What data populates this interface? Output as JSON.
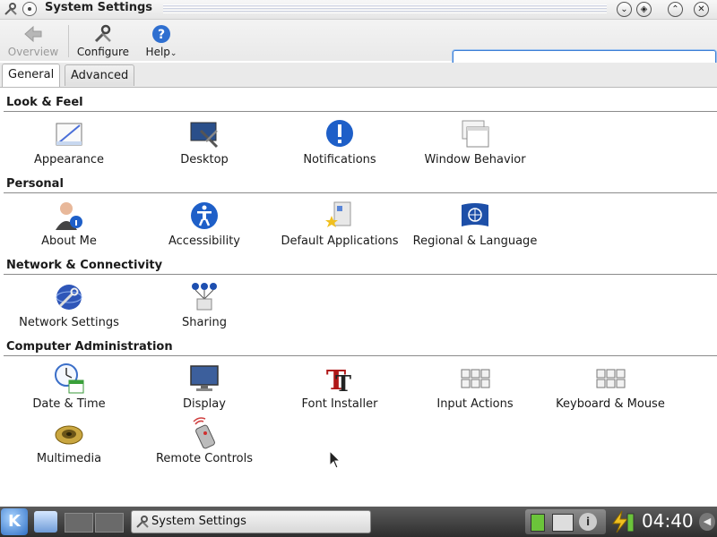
{
  "window": {
    "title": "System Settings"
  },
  "toolbar": {
    "overview_label": "Overview",
    "configure_label": "Configure",
    "help_label": "Help"
  },
  "search": {
    "placeholder": "",
    "value": ""
  },
  "tabs": [
    {
      "label": "General",
      "active": true
    },
    {
      "label": "Advanced",
      "active": false
    }
  ],
  "categories": [
    {
      "title": "Look & Feel",
      "items": [
        {
          "label": "Appearance",
          "icon": "appearance-icon"
        },
        {
          "label": "Desktop",
          "icon": "desktop-icon"
        },
        {
          "label": "Notifications",
          "icon": "notifications-icon"
        },
        {
          "label": "Window Behavior",
          "icon": "window-behavior-icon"
        }
      ]
    },
    {
      "title": "Personal",
      "items": [
        {
          "label": "About Me",
          "icon": "about-me-icon"
        },
        {
          "label": "Accessibility",
          "icon": "accessibility-icon"
        },
        {
          "label": "Default Applications",
          "icon": "default-applications-icon"
        },
        {
          "label": "Regional & Language",
          "icon": "regional-language-icon"
        }
      ]
    },
    {
      "title": "Network & Connectivity",
      "items": [
        {
          "label": "Network Settings",
          "icon": "network-settings-icon"
        },
        {
          "label": "Sharing",
          "icon": "sharing-icon"
        }
      ]
    },
    {
      "title": "Computer Administration",
      "items": [
        {
          "label": "Date & Time",
          "icon": "date-time-icon"
        },
        {
          "label": "Display",
          "icon": "display-icon"
        },
        {
          "label": "Font Installer",
          "icon": "font-installer-icon"
        },
        {
          "label": "Input Actions",
          "icon": "input-actions-icon"
        },
        {
          "label": "Keyboard & Mouse",
          "icon": "keyboard-mouse-icon"
        },
        {
          "label": "Multimedia",
          "icon": "multimedia-icon"
        },
        {
          "label": "Remote Controls",
          "icon": "remote-controls-icon"
        }
      ]
    }
  ],
  "taskbar": {
    "task_label": "System Settings",
    "clock": "04:40"
  },
  "colors": {
    "accent": "#3d7fd6",
    "taskbar": "#3a3a3a"
  }
}
